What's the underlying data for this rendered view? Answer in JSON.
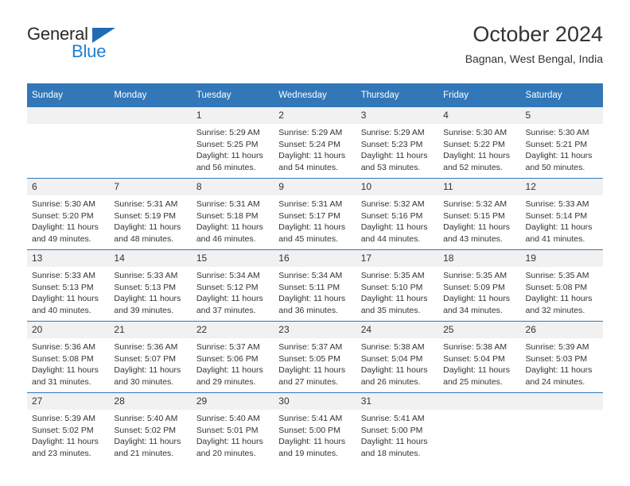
{
  "brand": {
    "name_part1": "General",
    "name_part2": "Blue",
    "triangle_color": "#1f6bb4",
    "blue_text_color": "#1f7fd0"
  },
  "header": {
    "title": "October 2024",
    "subtitle": "Bagnan, West Bengal, India"
  },
  "theme": {
    "header_row_bg": "#3277b8",
    "daynum_bg": "#f1f1f1",
    "text_color": "#333333"
  },
  "weekdays": [
    "Sunday",
    "Monday",
    "Tuesday",
    "Wednesday",
    "Thursday",
    "Friday",
    "Saturday"
  ],
  "labels": {
    "sunrise_prefix": "Sunrise:",
    "sunset_prefix": "Sunset:",
    "daylight_prefix": "Daylight:"
  },
  "weeks": [
    [
      {
        "day": "",
        "empty": true
      },
      {
        "day": "",
        "empty": true
      },
      {
        "day": "1",
        "sunrise": "Sunrise: 5:29 AM",
        "sunset": "Sunset: 5:25 PM",
        "daylight1": "Daylight: 11 hours",
        "daylight2": "and 56 minutes."
      },
      {
        "day": "2",
        "sunrise": "Sunrise: 5:29 AM",
        "sunset": "Sunset: 5:24 PM",
        "daylight1": "Daylight: 11 hours",
        "daylight2": "and 54 minutes."
      },
      {
        "day": "3",
        "sunrise": "Sunrise: 5:29 AM",
        "sunset": "Sunset: 5:23 PM",
        "daylight1": "Daylight: 11 hours",
        "daylight2": "and 53 minutes."
      },
      {
        "day": "4",
        "sunrise": "Sunrise: 5:30 AM",
        "sunset": "Sunset: 5:22 PM",
        "daylight1": "Daylight: 11 hours",
        "daylight2": "and 52 minutes."
      },
      {
        "day": "5",
        "sunrise": "Sunrise: 5:30 AM",
        "sunset": "Sunset: 5:21 PM",
        "daylight1": "Daylight: 11 hours",
        "daylight2": "and 50 minutes."
      }
    ],
    [
      {
        "day": "6",
        "sunrise": "Sunrise: 5:30 AM",
        "sunset": "Sunset: 5:20 PM",
        "daylight1": "Daylight: 11 hours",
        "daylight2": "and 49 minutes."
      },
      {
        "day": "7",
        "sunrise": "Sunrise: 5:31 AM",
        "sunset": "Sunset: 5:19 PM",
        "daylight1": "Daylight: 11 hours",
        "daylight2": "and 48 minutes."
      },
      {
        "day": "8",
        "sunrise": "Sunrise: 5:31 AM",
        "sunset": "Sunset: 5:18 PM",
        "daylight1": "Daylight: 11 hours",
        "daylight2": "and 46 minutes."
      },
      {
        "day": "9",
        "sunrise": "Sunrise: 5:31 AM",
        "sunset": "Sunset: 5:17 PM",
        "daylight1": "Daylight: 11 hours",
        "daylight2": "and 45 minutes."
      },
      {
        "day": "10",
        "sunrise": "Sunrise: 5:32 AM",
        "sunset": "Sunset: 5:16 PM",
        "daylight1": "Daylight: 11 hours",
        "daylight2": "and 44 minutes."
      },
      {
        "day": "11",
        "sunrise": "Sunrise: 5:32 AM",
        "sunset": "Sunset: 5:15 PM",
        "daylight1": "Daylight: 11 hours",
        "daylight2": "and 43 minutes."
      },
      {
        "day": "12",
        "sunrise": "Sunrise: 5:33 AM",
        "sunset": "Sunset: 5:14 PM",
        "daylight1": "Daylight: 11 hours",
        "daylight2": "and 41 minutes."
      }
    ],
    [
      {
        "day": "13",
        "sunrise": "Sunrise: 5:33 AM",
        "sunset": "Sunset: 5:13 PM",
        "daylight1": "Daylight: 11 hours",
        "daylight2": "and 40 minutes."
      },
      {
        "day": "14",
        "sunrise": "Sunrise: 5:33 AM",
        "sunset": "Sunset: 5:13 PM",
        "daylight1": "Daylight: 11 hours",
        "daylight2": "and 39 minutes."
      },
      {
        "day": "15",
        "sunrise": "Sunrise: 5:34 AM",
        "sunset": "Sunset: 5:12 PM",
        "daylight1": "Daylight: 11 hours",
        "daylight2": "and 37 minutes."
      },
      {
        "day": "16",
        "sunrise": "Sunrise: 5:34 AM",
        "sunset": "Sunset: 5:11 PM",
        "daylight1": "Daylight: 11 hours",
        "daylight2": "and 36 minutes."
      },
      {
        "day": "17",
        "sunrise": "Sunrise: 5:35 AM",
        "sunset": "Sunset: 5:10 PM",
        "daylight1": "Daylight: 11 hours",
        "daylight2": "and 35 minutes."
      },
      {
        "day": "18",
        "sunrise": "Sunrise: 5:35 AM",
        "sunset": "Sunset: 5:09 PM",
        "daylight1": "Daylight: 11 hours",
        "daylight2": "and 34 minutes."
      },
      {
        "day": "19",
        "sunrise": "Sunrise: 5:35 AM",
        "sunset": "Sunset: 5:08 PM",
        "daylight1": "Daylight: 11 hours",
        "daylight2": "and 32 minutes."
      }
    ],
    [
      {
        "day": "20",
        "sunrise": "Sunrise: 5:36 AM",
        "sunset": "Sunset: 5:08 PM",
        "daylight1": "Daylight: 11 hours",
        "daylight2": "and 31 minutes."
      },
      {
        "day": "21",
        "sunrise": "Sunrise: 5:36 AM",
        "sunset": "Sunset: 5:07 PM",
        "daylight1": "Daylight: 11 hours",
        "daylight2": "and 30 minutes."
      },
      {
        "day": "22",
        "sunrise": "Sunrise: 5:37 AM",
        "sunset": "Sunset: 5:06 PM",
        "daylight1": "Daylight: 11 hours",
        "daylight2": "and 29 minutes."
      },
      {
        "day": "23",
        "sunrise": "Sunrise: 5:37 AM",
        "sunset": "Sunset: 5:05 PM",
        "daylight1": "Daylight: 11 hours",
        "daylight2": "and 27 minutes."
      },
      {
        "day": "24",
        "sunrise": "Sunrise: 5:38 AM",
        "sunset": "Sunset: 5:04 PM",
        "daylight1": "Daylight: 11 hours",
        "daylight2": "and 26 minutes."
      },
      {
        "day": "25",
        "sunrise": "Sunrise: 5:38 AM",
        "sunset": "Sunset: 5:04 PM",
        "daylight1": "Daylight: 11 hours",
        "daylight2": "and 25 minutes."
      },
      {
        "day": "26",
        "sunrise": "Sunrise: 5:39 AM",
        "sunset": "Sunset: 5:03 PM",
        "daylight1": "Daylight: 11 hours",
        "daylight2": "and 24 minutes."
      }
    ],
    [
      {
        "day": "27",
        "sunrise": "Sunrise: 5:39 AM",
        "sunset": "Sunset: 5:02 PM",
        "daylight1": "Daylight: 11 hours",
        "daylight2": "and 23 minutes."
      },
      {
        "day": "28",
        "sunrise": "Sunrise: 5:40 AM",
        "sunset": "Sunset: 5:02 PM",
        "daylight1": "Daylight: 11 hours",
        "daylight2": "and 21 minutes."
      },
      {
        "day": "29",
        "sunrise": "Sunrise: 5:40 AM",
        "sunset": "Sunset: 5:01 PM",
        "daylight1": "Daylight: 11 hours",
        "daylight2": "and 20 minutes."
      },
      {
        "day": "30",
        "sunrise": "Sunrise: 5:41 AM",
        "sunset": "Sunset: 5:00 PM",
        "daylight1": "Daylight: 11 hours",
        "daylight2": "and 19 minutes."
      },
      {
        "day": "31",
        "sunrise": "Sunrise: 5:41 AM",
        "sunset": "Sunset: 5:00 PM",
        "daylight1": "Daylight: 11 hours",
        "daylight2": "and 18 minutes."
      },
      {
        "day": "",
        "empty": true
      },
      {
        "day": "",
        "empty": true
      }
    ]
  ]
}
